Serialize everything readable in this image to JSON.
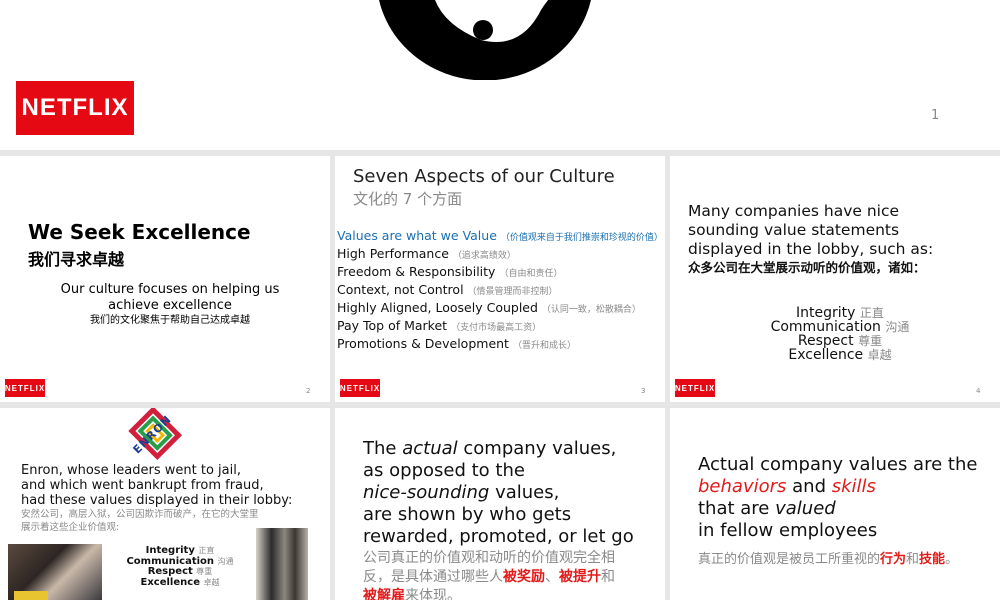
{
  "slide1": {
    "logo": "NETFLIX",
    "page": "1"
  },
  "slide2": {
    "title": "We Seek Excellence",
    "title_cn": "我们寻求卓越",
    "body_line1": "Our culture focuses on helping us",
    "body_line2": "achieve excellence",
    "body_cn": "我们的文化聚焦于帮助自己达成卓越",
    "logo": "NETFLIX",
    "page": "2"
  },
  "slide3": {
    "title": "Seven Aspects of our Culture",
    "title_cn": "文化的 7 个方面",
    "items": [
      {
        "en": "Values are what we Value",
        "cn": "（价值观来自于我们推崇和珍视的价值）"
      },
      {
        "en": "High Performance",
        "cn": "（追求高绩效）"
      },
      {
        "en": "Freedom & Responsibility",
        "cn": "（自由和责任）"
      },
      {
        "en": "Context, not Control",
        "cn": "（情景管理而非控制）"
      },
      {
        "en": "Highly Aligned, Loosely Coupled",
        "cn": "（认同一致，松散耦合）"
      },
      {
        "en": "Pay Top of Market",
        "cn": "（支付市场最高工资）"
      },
      {
        "en": "Promotions & Development",
        "cn": "（晋升和成长）"
      }
    ],
    "logo": "NETFLIX",
    "page": "3"
  },
  "slide4": {
    "line1": "Many companies have nice",
    "line2": "sounding value statements",
    "line3": "displayed in the lobby, such as:",
    "line_cn": "众多公司在大堂展示动听的价值观，诸如：",
    "values": [
      {
        "en": "Integrity",
        "cn": "正直"
      },
      {
        "en": "Communication",
        "cn": "沟通"
      },
      {
        "en": "Respect",
        "cn": "尊重"
      },
      {
        "en": "Excellence",
        "cn": "卓越"
      }
    ],
    "logo": "NETFLIX",
    "page": "4"
  },
  "slide5": {
    "enron": "ENRON",
    "line1": "Enron, whose leaders went to jail,",
    "line2": "and which went bankrupt from fraud,",
    "line3": "had these values displayed in their lobby:",
    "cn1": "安然公司，高层入狱，公司因欺诈而破产，在它的大堂里",
    "cn2": "展示着这些企业价值观:",
    "values": [
      {
        "en": "Integrity",
        "cn": "正直"
      },
      {
        "en": "Communication",
        "cn": "沟通"
      },
      {
        "en": "Respect",
        "cn": "尊重"
      },
      {
        "en": "Excellence",
        "cn": "卓越"
      }
    ]
  },
  "slide6": {
    "t1": "The",
    "t2": "actual",
    "t3": "company values,",
    "t4": "as opposed to the",
    "t5": "nice-sounding",
    "t6": "values,",
    "t7": "are shown by who gets",
    "t8": "rewarded, promoted, or let go",
    "cn1": "公司真正的价值观和动听的价值观完全相",
    "cn2a": "反，是具体通过哪些人",
    "cn2b": "被奖励",
    "cn2c": "、",
    "cn2d": "被提升",
    "cn2e": "和",
    "cn3a": "被解雇",
    "cn3b": "来体现。"
  },
  "slide7": {
    "l1": "Actual company values are the",
    "l2a": "behaviors",
    "l2b": "and",
    "l2c": "skills",
    "l3a": "that are",
    "l3b": "valued",
    "l4": "in fellow employees",
    "cn_a": "真正的价值观是被员工所重视的",
    "cn_b": "行为",
    "cn_c": "和",
    "cn_d": "技能",
    "cn_e": "。"
  }
}
